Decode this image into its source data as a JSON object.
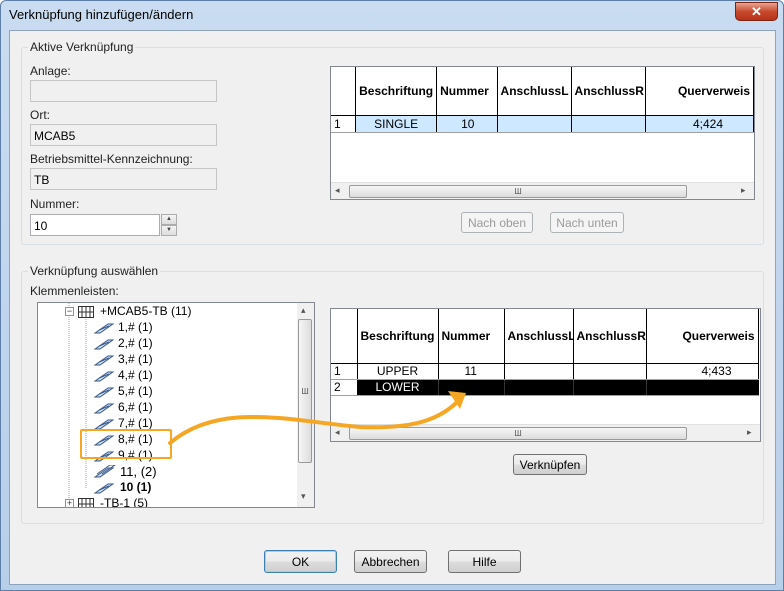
{
  "window": {
    "title": "Verknüpfung hinzufügen/ändern",
    "close_glyph": "✕"
  },
  "active_group": {
    "legend": "Aktive Verknüpfung",
    "anlage": {
      "label": "Anlage:",
      "value": ""
    },
    "ort": {
      "label": "Ort:",
      "value": "MCAB5"
    },
    "bmk": {
      "label": "Betriebsmittel-Kennzeichnung:",
      "value": "TB"
    },
    "nummer": {
      "label": "Nummer:",
      "value": "10"
    },
    "grid": {
      "columns": [
        "Beschriftung",
        "Nummer",
        "AnschlussL",
        "AnschlussR",
        "Querverweis"
      ],
      "rows": [
        {
          "idx": "1",
          "cells": [
            "SINGLE",
            "10",
            "",
            "",
            "4;424"
          ]
        }
      ]
    },
    "btn_up": "Nach oben",
    "btn_down": "Nach unten"
  },
  "select_group": {
    "legend": "Verknüpfung auswählen",
    "tree_label": "Klemmenleisten:",
    "tree": [
      {
        "label": "+MCAB5-TB (11)",
        "kind": "strip",
        "expanded": true
      },
      {
        "label": "1,# (1)",
        "kind": "terminal"
      },
      {
        "label": "2,# (1)",
        "kind": "terminal"
      },
      {
        "label": "3,# (1)",
        "kind": "terminal"
      },
      {
        "label": "4,# (1)",
        "kind": "terminal"
      },
      {
        "label": "5,# (1)",
        "kind": "terminal"
      },
      {
        "label": "6,# (1)",
        "kind": "terminal"
      },
      {
        "label": "7,# (1)",
        "kind": "terminal"
      },
      {
        "label": "8,# (1)",
        "kind": "terminal"
      },
      {
        "label": "9,# (1)",
        "kind": "terminal"
      },
      {
        "label": "11,  (2)",
        "kind": "terminal-multi"
      },
      {
        "label": "10 (1)",
        "kind": "terminal-bold"
      },
      {
        "label": "-TB-1 (5)",
        "kind": "strip",
        "expanded": false
      }
    ],
    "grid": {
      "columns": [
        "Beschriftung",
        "Nummer",
        "AnschlussL",
        "AnschlussR",
        "Querverweis"
      ],
      "rows": [
        {
          "idx": "1",
          "cells": [
            "UPPER",
            "11",
            "",
            "",
            "4;433"
          ],
          "selected": false
        },
        {
          "idx": "2",
          "cells": [
            "LOWER",
            "",
            "",
            "",
            ""
          ],
          "selected": true
        }
      ]
    },
    "btn_link": "Verknüpfen"
  },
  "footer": {
    "ok": "OK",
    "cancel": "Abbrechen",
    "help": "Hilfe"
  },
  "colors": {
    "annotation": "#f5a623",
    "selected_row": "#000000",
    "highlight_row": "#cde8ff"
  },
  "icons": {
    "strip": "terminal-strip-icon",
    "terminal": "terminal-icon",
    "scroll_grip": "Ш"
  }
}
